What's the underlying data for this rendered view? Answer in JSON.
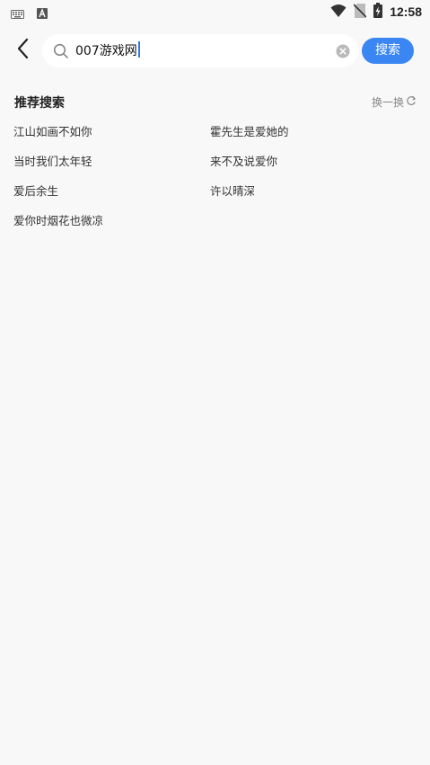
{
  "status_bar": {
    "time": "12:58",
    "icons": [
      "keyboard-icon",
      "a-icon",
      "wifi-icon",
      "no-sim-icon",
      "battery-charging-icon"
    ]
  },
  "search": {
    "back_icon": "chevron-left-icon",
    "search_icon": "magnifier-icon",
    "value": "007游戏网",
    "clear_icon": "clear-icon",
    "button_label": "搜索"
  },
  "recommend": {
    "title": "推荐搜索",
    "refresh_label": "换一换",
    "refresh_icon": "refresh-icon",
    "items": [
      "江山如画不如你",
      "霍先生是爱她的",
      "当时我们太年轻",
      "来不及说爱你",
      "爱后余生",
      "许以晴深",
      "爱你时烟花也微凉"
    ]
  },
  "colors": {
    "background": "#f8f8f8",
    "accent": "#3a86f2",
    "caret": "#2b7cf0"
  }
}
